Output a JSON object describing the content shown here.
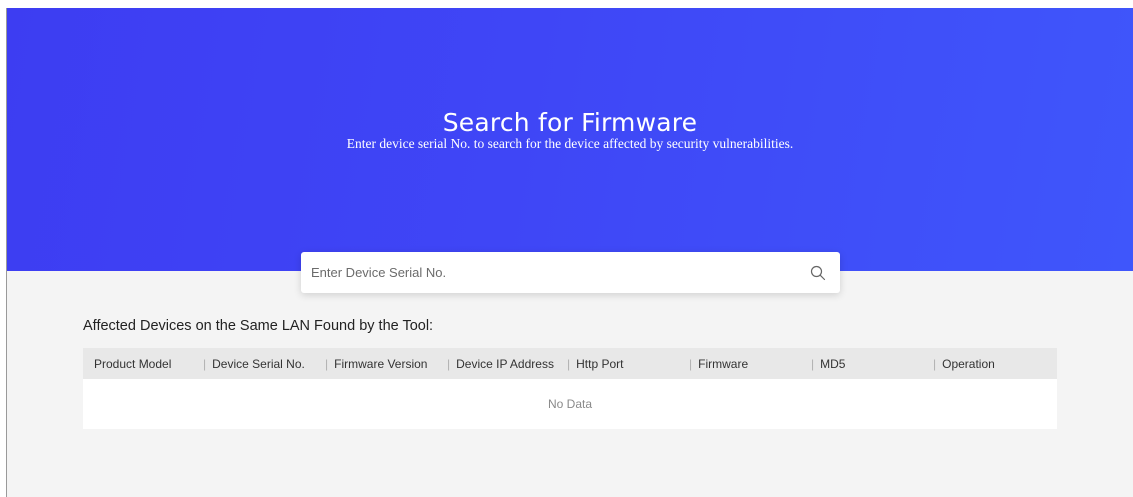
{
  "hero": {
    "title": "Search for Firmware",
    "subtitle": "Enter device serial No. to search for the device affected by security vulnerabilities."
  },
  "search": {
    "placeholder": "Enter Device Serial No.",
    "value": "",
    "icon": "search-icon"
  },
  "section": {
    "title": "Affected Devices on the Same LAN Found by the Tool:"
  },
  "table": {
    "columns": [
      "Product Model",
      "Device Serial No.",
      "Firmware Version",
      "Device IP Address",
      "Http Port",
      "Firmware",
      "MD5",
      "Operation"
    ],
    "empty_text": "No Data",
    "rows": []
  },
  "colors": {
    "hero_start": "#3d3df2",
    "hero_end": "#3f56fb",
    "background": "#f4f4f4",
    "table_header": "#e8e8e8"
  }
}
